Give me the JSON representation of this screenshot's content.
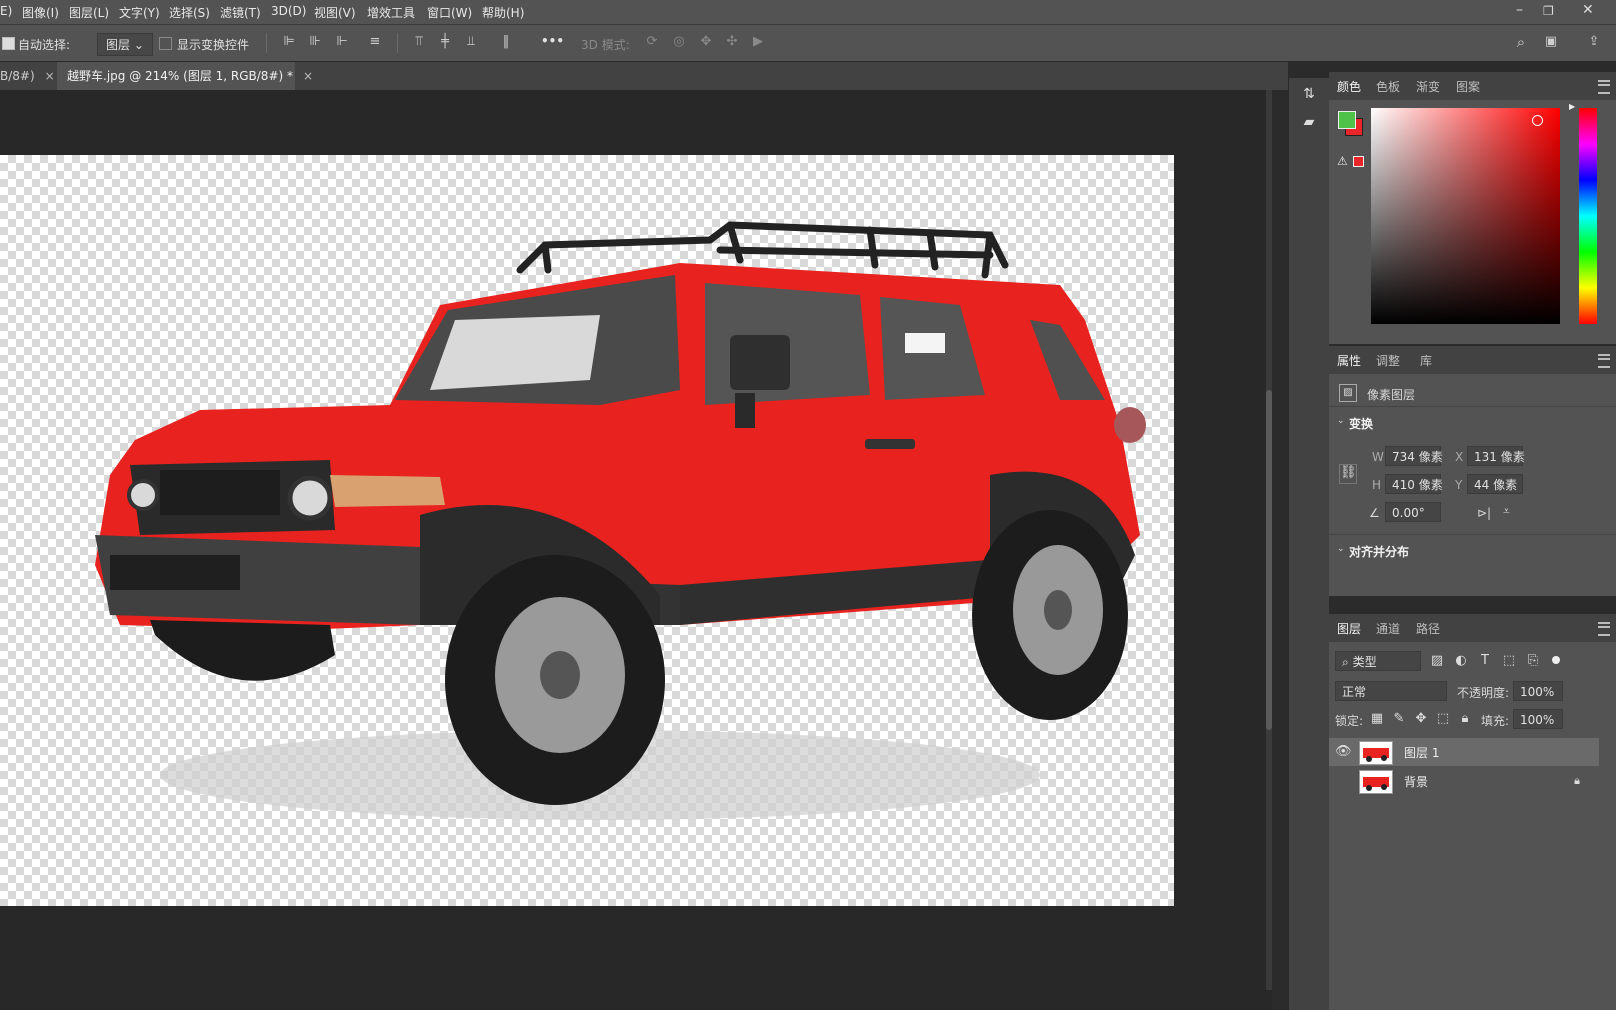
{
  "menu": {
    "items": [
      "E)",
      "图像(I)",
      "图层(L)",
      "文字(Y)",
      "选择(S)",
      "滤镜(T)",
      "3D(D)",
      "视图(V)",
      "增效工具",
      "窗口(W)",
      "帮助(H)"
    ]
  },
  "options": {
    "auto_select_label": "自动选择:",
    "auto_select_value": "图层",
    "show_transform_label": "显示变换控件",
    "more_label": "•••",
    "mode_3d_label": "3D 模式:"
  },
  "tabs": [
    {
      "label": "B/8#)",
      "close": "×"
    },
    {
      "label": "越野车.jpg @ 214% (图层 1, RGB/8#) *",
      "close": "×"
    }
  ],
  "color_panel": {
    "tabs": [
      "颜色",
      "色板",
      "渐变",
      "图案"
    ],
    "foreground": "#4fc24a",
    "background": "#e8262a"
  },
  "properties": {
    "tabs": [
      "属性",
      "调整",
      "库"
    ],
    "layer_type": "像素图层",
    "transform_header": "变换",
    "w_label": "W",
    "w_value": "734 像素",
    "x_label": "X",
    "x_value": "131 像素",
    "h_label": "H",
    "h_value": "410 像素",
    "y_label": "Y",
    "y_value": "44 像素",
    "angle_value": "0.00°",
    "align_header": "对齐并分布"
  },
  "layers": {
    "tabs": [
      "图层",
      "通道",
      "路径"
    ],
    "filter_label": "类型",
    "blend_mode": "正常",
    "opacity_label": "不透明度:",
    "opacity_value": "100%",
    "lock_label": "锁定:",
    "fill_label": "填充:",
    "fill_value": "100%",
    "items": [
      {
        "name": "图层 1",
        "visible": true,
        "selected": true
      },
      {
        "name": "背景",
        "visible": false,
        "locked": true
      }
    ]
  }
}
